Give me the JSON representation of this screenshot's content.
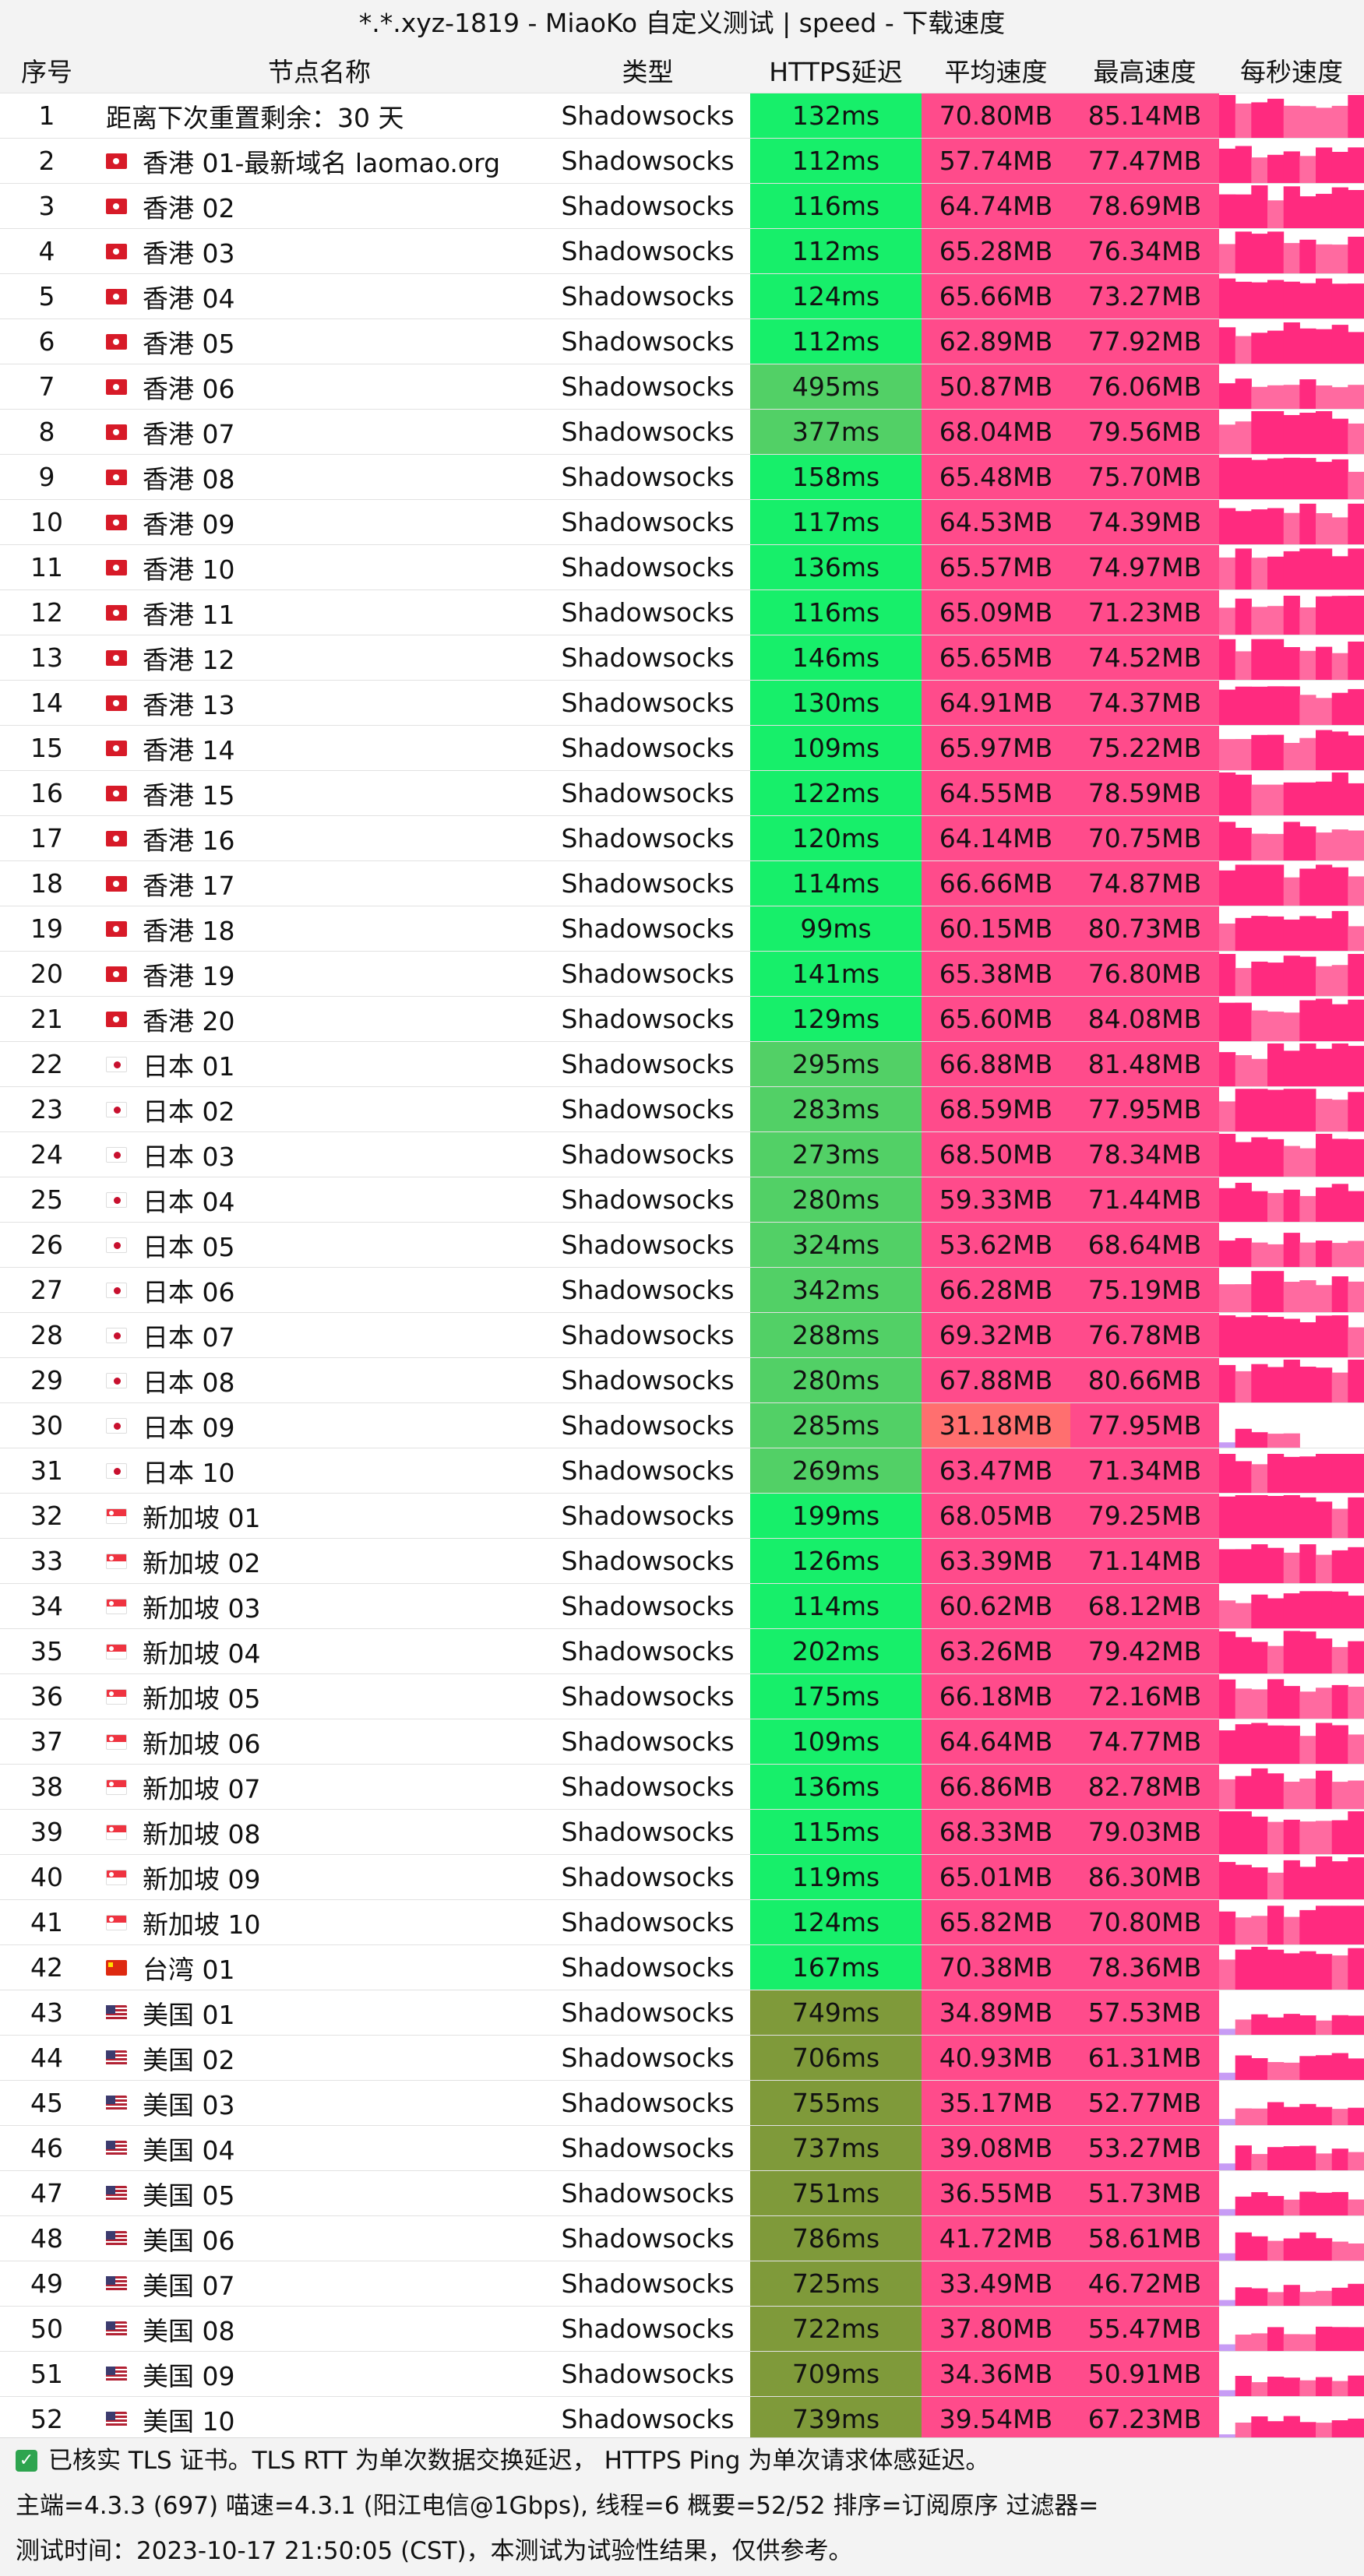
{
  "title": "*.*.xyz-1819 - MiaoKo 自定义测试 | speed - 下载速度",
  "headers": {
    "index": "序号",
    "name": "节点名称",
    "type": "类型",
    "latency": "HTTPS延迟",
    "avg": "平均速度",
    "max": "最高速度",
    "spark": "每秒速度"
  },
  "colors": {
    "latency_fast": "#17ef6a",
    "latency_mid": "#52d066",
    "latency_slow": "#7f9a3a",
    "speed_good": "#ff4b8b",
    "speed_low": "#ff6f6f",
    "spark_high": "#ff2a7f",
    "spark_low": "#ff6aa0",
    "spark_min": "#c79cf5"
  },
  "rows": [
    {
      "idx": "1",
      "name": "距离下次重置剩余：30 天",
      "flag": "",
      "type": "Shadowsocks",
      "latency": "132ms",
      "avg": "70.80MB",
      "max": "85.14MB"
    },
    {
      "idx": "2",
      "name": "香港 01-最新域名 laomao.org",
      "flag": "hk",
      "type": "Shadowsocks",
      "latency": "112ms",
      "avg": "57.74MB",
      "max": "77.47MB"
    },
    {
      "idx": "3",
      "name": "香港 02",
      "flag": "hk",
      "type": "Shadowsocks",
      "latency": "116ms",
      "avg": "64.74MB",
      "max": "78.69MB"
    },
    {
      "idx": "4",
      "name": "香港 03",
      "flag": "hk",
      "type": "Shadowsocks",
      "latency": "112ms",
      "avg": "65.28MB",
      "max": "76.34MB"
    },
    {
      "idx": "5",
      "name": "香港 04",
      "flag": "hk",
      "type": "Shadowsocks",
      "latency": "124ms",
      "avg": "65.66MB",
      "max": "73.27MB"
    },
    {
      "idx": "6",
      "name": "香港 05",
      "flag": "hk",
      "type": "Shadowsocks",
      "latency": "112ms",
      "avg": "62.89MB",
      "max": "77.92MB"
    },
    {
      "idx": "7",
      "name": "香港 06",
      "flag": "hk",
      "type": "Shadowsocks",
      "latency": "495ms",
      "avg": "50.87MB",
      "max": "76.06MB"
    },
    {
      "idx": "8",
      "name": "香港 07",
      "flag": "hk",
      "type": "Shadowsocks",
      "latency": "377ms",
      "avg": "68.04MB",
      "max": "79.56MB"
    },
    {
      "idx": "9",
      "name": "香港 08",
      "flag": "hk",
      "type": "Shadowsocks",
      "latency": "158ms",
      "avg": "65.48MB",
      "max": "75.70MB"
    },
    {
      "idx": "10",
      "name": "香港 09",
      "flag": "hk",
      "type": "Shadowsocks",
      "latency": "117ms",
      "avg": "64.53MB",
      "max": "74.39MB"
    },
    {
      "idx": "11",
      "name": "香港 10",
      "flag": "hk",
      "type": "Shadowsocks",
      "latency": "136ms",
      "avg": "65.57MB",
      "max": "74.97MB"
    },
    {
      "idx": "12",
      "name": "香港 11",
      "flag": "hk",
      "type": "Shadowsocks",
      "latency": "116ms",
      "avg": "65.09MB",
      "max": "71.23MB"
    },
    {
      "idx": "13",
      "name": "香港 12",
      "flag": "hk",
      "type": "Shadowsocks",
      "latency": "146ms",
      "avg": "65.65MB",
      "max": "74.52MB"
    },
    {
      "idx": "14",
      "name": "香港 13",
      "flag": "hk",
      "type": "Shadowsocks",
      "latency": "130ms",
      "avg": "64.91MB",
      "max": "74.37MB"
    },
    {
      "idx": "15",
      "name": "香港 14",
      "flag": "hk",
      "type": "Shadowsocks",
      "latency": "109ms",
      "avg": "65.97MB",
      "max": "75.22MB"
    },
    {
      "idx": "16",
      "name": "香港 15",
      "flag": "hk",
      "type": "Shadowsocks",
      "latency": "122ms",
      "avg": "64.55MB",
      "max": "78.59MB"
    },
    {
      "idx": "17",
      "name": "香港 16",
      "flag": "hk",
      "type": "Shadowsocks",
      "latency": "120ms",
      "avg": "64.14MB",
      "max": "70.75MB"
    },
    {
      "idx": "18",
      "name": "香港 17",
      "flag": "hk",
      "type": "Shadowsocks",
      "latency": "114ms",
      "avg": "66.66MB",
      "max": "74.87MB"
    },
    {
      "idx": "19",
      "name": "香港 18",
      "flag": "hk",
      "type": "Shadowsocks",
      "latency": "99ms",
      "avg": "60.15MB",
      "max": "80.73MB"
    },
    {
      "idx": "20",
      "name": "香港 19",
      "flag": "hk",
      "type": "Shadowsocks",
      "latency": "141ms",
      "avg": "65.38MB",
      "max": "76.80MB"
    },
    {
      "idx": "21",
      "name": "香港 20",
      "flag": "hk",
      "type": "Shadowsocks",
      "latency": "129ms",
      "avg": "65.60MB",
      "max": "84.08MB"
    },
    {
      "idx": "22",
      "name": "日本 01",
      "flag": "jp",
      "type": "Shadowsocks",
      "latency": "295ms",
      "avg": "66.88MB",
      "max": "81.48MB"
    },
    {
      "idx": "23",
      "name": "日本 02",
      "flag": "jp",
      "type": "Shadowsocks",
      "latency": "283ms",
      "avg": "68.59MB",
      "max": "77.95MB"
    },
    {
      "idx": "24",
      "name": "日本 03",
      "flag": "jp",
      "type": "Shadowsocks",
      "latency": "273ms",
      "avg": "68.50MB",
      "max": "78.34MB"
    },
    {
      "idx": "25",
      "name": "日本 04",
      "flag": "jp",
      "type": "Shadowsocks",
      "latency": "280ms",
      "avg": "59.33MB",
      "max": "71.44MB"
    },
    {
      "idx": "26",
      "name": "日本 05",
      "flag": "jp",
      "type": "Shadowsocks",
      "latency": "324ms",
      "avg": "53.62MB",
      "max": "68.64MB"
    },
    {
      "idx": "27",
      "name": "日本 06",
      "flag": "jp",
      "type": "Shadowsocks",
      "latency": "342ms",
      "avg": "66.28MB",
      "max": "75.19MB"
    },
    {
      "idx": "28",
      "name": "日本 07",
      "flag": "jp",
      "type": "Shadowsocks",
      "latency": "288ms",
      "avg": "69.32MB",
      "max": "76.78MB"
    },
    {
      "idx": "29",
      "name": "日本 08",
      "flag": "jp",
      "type": "Shadowsocks",
      "latency": "280ms",
      "avg": "67.88MB",
      "max": "80.66MB"
    },
    {
      "idx": "30",
      "name": "日本 09",
      "flag": "jp",
      "type": "Shadowsocks",
      "latency": "285ms",
      "avg": "31.18MB",
      "max": "77.95MB"
    },
    {
      "idx": "31",
      "name": "日本 10",
      "flag": "jp",
      "type": "Shadowsocks",
      "latency": "269ms",
      "avg": "63.47MB",
      "max": "71.34MB"
    },
    {
      "idx": "32",
      "name": "新加坡 01",
      "flag": "sg",
      "type": "Shadowsocks",
      "latency": "199ms",
      "avg": "68.05MB",
      "max": "79.25MB"
    },
    {
      "idx": "33",
      "name": "新加坡 02",
      "flag": "sg",
      "type": "Shadowsocks",
      "latency": "126ms",
      "avg": "63.39MB",
      "max": "71.14MB"
    },
    {
      "idx": "34",
      "name": "新加坡 03",
      "flag": "sg",
      "type": "Shadowsocks",
      "latency": "114ms",
      "avg": "60.62MB",
      "max": "68.12MB"
    },
    {
      "idx": "35",
      "name": "新加坡 04",
      "flag": "sg",
      "type": "Shadowsocks",
      "latency": "202ms",
      "avg": "63.26MB",
      "max": "79.42MB"
    },
    {
      "idx": "36",
      "name": "新加坡 05",
      "flag": "sg",
      "type": "Shadowsocks",
      "latency": "175ms",
      "avg": "66.18MB",
      "max": "72.16MB"
    },
    {
      "idx": "37",
      "name": "新加坡 06",
      "flag": "sg",
      "type": "Shadowsocks",
      "latency": "109ms",
      "avg": "64.64MB",
      "max": "74.77MB"
    },
    {
      "idx": "38",
      "name": "新加坡 07",
      "flag": "sg",
      "type": "Shadowsocks",
      "latency": "136ms",
      "avg": "66.86MB",
      "max": "82.78MB"
    },
    {
      "idx": "39",
      "name": "新加坡 08",
      "flag": "sg",
      "type": "Shadowsocks",
      "latency": "115ms",
      "avg": "68.33MB",
      "max": "79.03MB"
    },
    {
      "idx": "40",
      "name": "新加坡 09",
      "flag": "sg",
      "type": "Shadowsocks",
      "latency": "119ms",
      "avg": "65.01MB",
      "max": "86.30MB"
    },
    {
      "idx": "41",
      "name": "新加坡 10",
      "flag": "sg",
      "type": "Shadowsocks",
      "latency": "124ms",
      "avg": "65.82MB",
      "max": "70.80MB"
    },
    {
      "idx": "42",
      "name": "台湾 01",
      "flag": "tw",
      "type": "Shadowsocks",
      "latency": "167ms",
      "avg": "70.38MB",
      "max": "78.36MB"
    },
    {
      "idx": "43",
      "name": "美国 01",
      "flag": "us",
      "type": "Shadowsocks",
      "latency": "749ms",
      "avg": "34.89MB",
      "max": "57.53MB"
    },
    {
      "idx": "44",
      "name": "美国 02",
      "flag": "us",
      "type": "Shadowsocks",
      "latency": "706ms",
      "avg": "40.93MB",
      "max": "61.31MB"
    },
    {
      "idx": "45",
      "name": "美国 03",
      "flag": "us",
      "type": "Shadowsocks",
      "latency": "755ms",
      "avg": "35.17MB",
      "max": "52.77MB"
    },
    {
      "idx": "46",
      "name": "美国 04",
      "flag": "us",
      "type": "Shadowsocks",
      "latency": "737ms",
      "avg": "39.08MB",
      "max": "53.27MB"
    },
    {
      "idx": "47",
      "name": "美国 05",
      "flag": "us",
      "type": "Shadowsocks",
      "latency": "751ms",
      "avg": "36.55MB",
      "max": "51.73MB"
    },
    {
      "idx": "48",
      "name": "美国 06",
      "flag": "us",
      "type": "Shadowsocks",
      "latency": "786ms",
      "avg": "41.72MB",
      "max": "58.61MB"
    },
    {
      "idx": "49",
      "name": "美国 07",
      "flag": "us",
      "type": "Shadowsocks",
      "latency": "725ms",
      "avg": "33.49MB",
      "max": "46.72MB"
    },
    {
      "idx": "50",
      "name": "美国 08",
      "flag": "us",
      "type": "Shadowsocks",
      "latency": "722ms",
      "avg": "37.80MB",
      "max": "55.47MB"
    },
    {
      "idx": "51",
      "name": "美国 09",
      "flag": "us",
      "type": "Shadowsocks",
      "latency": "709ms",
      "avg": "34.36MB",
      "max": "50.91MB"
    },
    {
      "idx": "52",
      "name": "美国 10",
      "flag": "us",
      "type": "Shadowsocks",
      "latency": "739ms",
      "avg": "39.54MB",
      "max": "67.23MB"
    }
  ],
  "footer": {
    "line1": "已核实 TLS 证书。TLS RTT 为单次数据交换延迟， HTTPS Ping 为单次请求体感延迟。",
    "line2": "主端=4.3.3 (697) 喵速=4.3.1 (阳江电信@1Gbps), 线程=6 概要=52/52 排序=订阅原序 过滤器=",
    "line3": "测试时间：2023-10-17 21:50:05 (CST)，本测试为试验性结果，仅供参考。"
  }
}
